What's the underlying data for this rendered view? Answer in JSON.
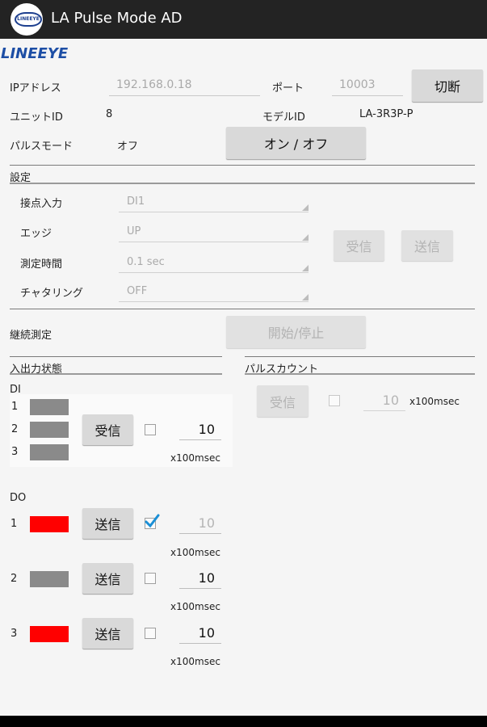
{
  "app": {
    "title": "LA Pulse Mode AD",
    "logo_text": "LINEEYE"
  },
  "brand": "LINEEYE",
  "connection": {
    "ip_label": "IPアドレス",
    "ip_value": "192.168.0.18",
    "port_label": "ポート",
    "port_value": "10003",
    "disconnect_label": "切断",
    "unit_id_label": "ユニットID",
    "unit_id_value": "8",
    "model_id_label": "モデルID",
    "model_id_value": "LA-3R3P-P",
    "pulse_mode_label": "パルスモード",
    "pulse_mode_value": "オフ",
    "onoff_label": "オン / オフ"
  },
  "settings": {
    "title": "設定",
    "rows": [
      {
        "label": "接点入力",
        "value": "DI1"
      },
      {
        "label": "エッジ",
        "value": "UP"
      },
      {
        "label": "測定時間",
        "value": "0.1 sec"
      },
      {
        "label": "チャタリング",
        "value": "OFF"
      }
    ],
    "receive_label": "受信",
    "send_label": "送信"
  },
  "continuous": {
    "label": "継続測定",
    "button": "開始/停止"
  },
  "io": {
    "title": "入出力状態",
    "di_title": "DI",
    "di_rows": [
      "1",
      "2",
      "3"
    ],
    "di_receive": "受信",
    "di_interval": "10",
    "unit": "x100msec",
    "do_title": "DO",
    "do_rows": [
      {
        "num": "1",
        "state": "on",
        "send": "送信",
        "checked": true,
        "interval": "10"
      },
      {
        "num": "2",
        "state": "off",
        "send": "送信",
        "checked": false,
        "interval": "10"
      },
      {
        "num": "3",
        "state": "on",
        "send": "送信",
        "checked": false,
        "interval": "10"
      }
    ]
  },
  "pulse_count": {
    "title": "パルスカウント",
    "receive": "受信",
    "interval": "10",
    "unit": "x100msec"
  },
  "colors": {
    "led_on": "#ff0000",
    "led_off": "#8a8a8a",
    "checkbox_accent": "#1a8fd6",
    "brand": "#1d4ea5"
  }
}
